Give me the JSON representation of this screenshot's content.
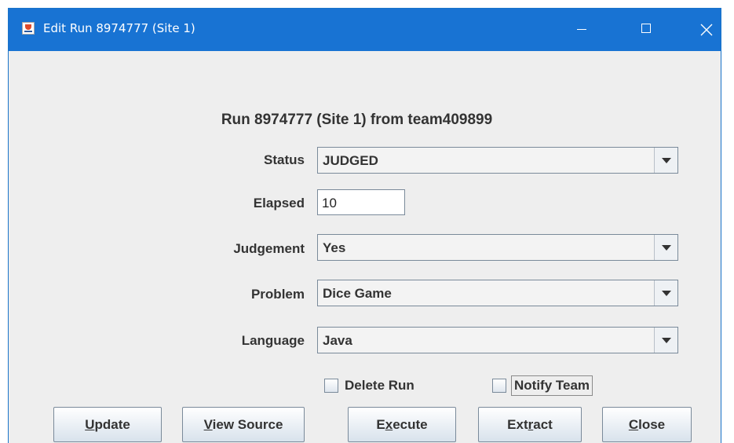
{
  "window": {
    "title": "Edit Run 8974777 (Site 1)",
    "controls": {
      "minimize": "minimize",
      "maximize": "maximize",
      "close": "close"
    },
    "accent_color": "#1873d3"
  },
  "heading": "Run 8974777 (Site 1) from team409899",
  "form": {
    "status": {
      "label": "Status",
      "value": "JUDGED"
    },
    "elapsed": {
      "label": "Elapsed",
      "value": "10"
    },
    "judgement": {
      "label": "Judgement",
      "value": "Yes"
    },
    "problem": {
      "label": "Problem",
      "value": "Dice Game"
    },
    "language": {
      "label": "Language",
      "value": "Java"
    }
  },
  "checkboxes": {
    "delete_run": {
      "label": "Delete Run",
      "checked": false
    },
    "notify_team": {
      "label": "Notify Team",
      "checked": false
    }
  },
  "buttons": {
    "update": {
      "mnemonic": "U",
      "rest": "pdate"
    },
    "view_source": {
      "mnemonic": "V",
      "rest": "iew Source"
    },
    "execute": {
      "pre": "E",
      "mnemonic": "x",
      "rest": "ecute"
    },
    "extract": {
      "pre": "Ext",
      "mnemonic": "r",
      "rest": "act"
    },
    "close": {
      "mnemonic": "C",
      "rest": "lose"
    }
  }
}
